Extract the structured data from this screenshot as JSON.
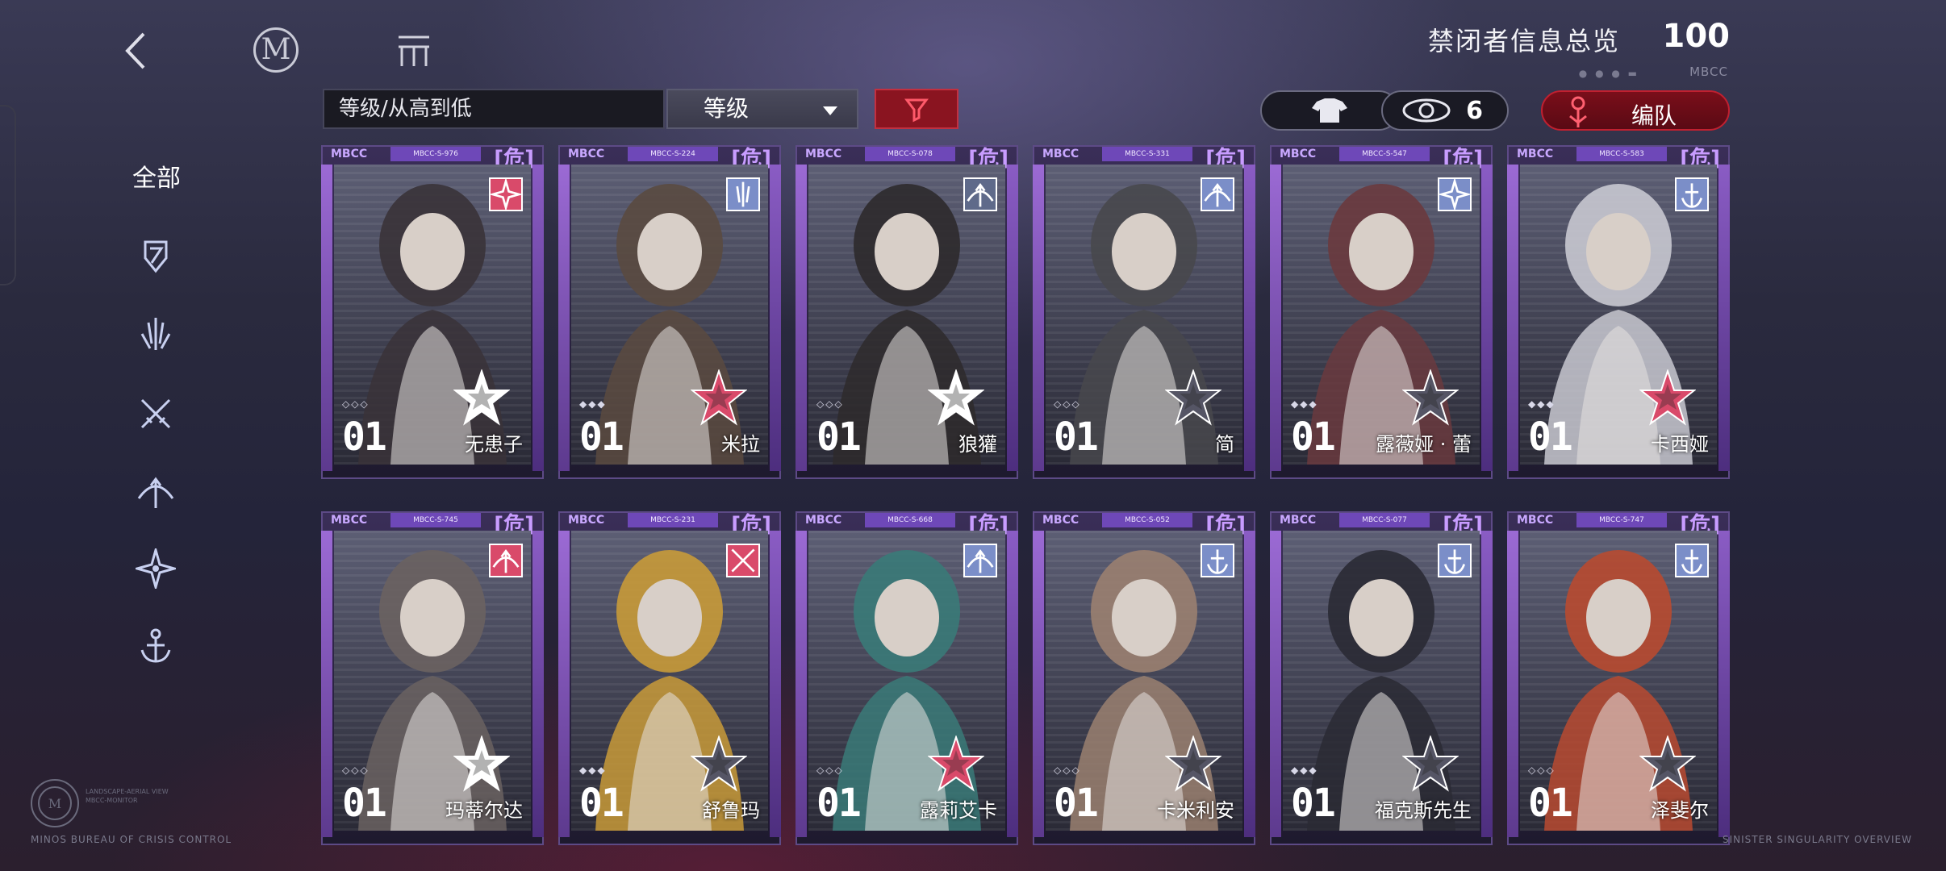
{
  "header": {
    "title": "禁闭者信息总览",
    "count": "100",
    "sub_tag": "MBCC",
    "dots": "● ● ● ▬"
  },
  "toolbar": {
    "sort_label": "等级/从高到低",
    "level_dropdown": "等级",
    "eye_count": "6",
    "team_label": "编队"
  },
  "sidebar": {
    "all_label": "全部",
    "filters": [
      "shield-icon",
      "claw-icon",
      "crossed-swords-icon",
      "bow-icon",
      "star-compass-icon",
      "anchor-icon"
    ]
  },
  "cards": [
    {
      "mbcc": "MBCC",
      "code": "MBCC-S-976",
      "danger": "[危]",
      "level": "01",
      "name": "无患子",
      "class_icon": "star-compass-icon",
      "class_color": "#d94a6a",
      "star_color": "#ffffff",
      "diamonds": "◇◇◇"
    },
    {
      "mbcc": "MBCC",
      "code": "MBCC-S-224",
      "danger": "[危]",
      "level": "01",
      "name": "米拉",
      "class_icon": "claw-icon",
      "class_color": "#7b8ec8",
      "star_color": "#d94a6a",
      "diamonds": "◆◆◆"
    },
    {
      "mbcc": "MBCC",
      "code": "MBCC-S-078",
      "danger": "[危]",
      "level": "01",
      "name": "狼獾",
      "class_icon": "bow-icon",
      "class_color": "#5f6a8a",
      "star_color": "#ffffff",
      "diamonds": "◇◇◇"
    },
    {
      "mbcc": "MBCC",
      "code": "MBCC-S-331",
      "danger": "[危]",
      "level": "01",
      "name": "简",
      "class_icon": "bow-icon",
      "class_color": "#7b8ec8",
      "star_color": "#555565",
      "diamonds": "◇◇◇"
    },
    {
      "mbcc": "MBCC",
      "code": "MBCC-S-547",
      "danger": "[危]",
      "level": "01",
      "name": "露薇娅 · 蕾",
      "class_icon": "star-compass-icon",
      "class_color": "#7b8ec8",
      "star_color": "#555565",
      "diamonds": "◆◆◆"
    },
    {
      "mbcc": "MBCC",
      "code": "MBCC-S-583",
      "danger": "[危]",
      "level": "01",
      "name": "卡西娅",
      "class_icon": "anchor-icon",
      "class_color": "#7b8ec8",
      "star_color": "#d94a6a",
      "diamonds": "◆◆◆"
    },
    {
      "mbcc": "MBCC",
      "code": "MBCC-S-745",
      "danger": "[危]",
      "level": "01",
      "name": "玛蒂尔达",
      "class_icon": "bow-icon",
      "class_color": "#d94a6a",
      "star_color": "#ffffff",
      "diamonds": "◇◇◇"
    },
    {
      "mbcc": "MBCC",
      "code": "MBCC-S-231",
      "danger": "[危]",
      "level": "01",
      "name": "舒鲁玛",
      "class_icon": "crossed-swords-icon",
      "class_color": "#d94a6a",
      "star_color": "#555565",
      "diamonds": "◆◆◆"
    },
    {
      "mbcc": "MBCC",
      "code": "MBCC-S-668",
      "danger": "[危]",
      "level": "01",
      "name": "露莉艾卡",
      "class_icon": "bow-icon",
      "class_color": "#7b8ec8",
      "star_color": "#d94a6a",
      "diamonds": "◇◇◇"
    },
    {
      "mbcc": "MBCC",
      "code": "MBCC-S-052",
      "danger": "[危]",
      "level": "01",
      "name": "卡米利安",
      "class_icon": "anchor-icon",
      "class_color": "#7b8ec8",
      "star_color": "#555565",
      "diamonds": "◇◇◇"
    },
    {
      "mbcc": "MBCC",
      "code": "MBCC-S-077",
      "danger": "[危]",
      "level": "01",
      "name": "福克斯先生",
      "class_icon": "anchor-icon",
      "class_color": "#7b8ec8",
      "star_color": "#555565",
      "diamonds": "◆◆◆"
    },
    {
      "mbcc": "MBCC",
      "code": "MBCC-S-747",
      "danger": "[危]",
      "level": "01",
      "name": "泽斐尔",
      "class_icon": "anchor-icon",
      "class_color": "#7b8ec8",
      "star_color": "#555565",
      "diamonds": "◇◇◇"
    }
  ],
  "footer": {
    "left_text": "MINOS BUREAU OF CRISIS CONTROL",
    "left_small": "LANDSCAPE-AERIAL VIEW\nMBCC-MONITOR",
    "right_text": "SINISTER SINGULARITY OVERVIEW"
  },
  "colors": {
    "accent_red": "#8a1420",
    "card_purple": "#6e48b8",
    "danger_violet": "#c89cff"
  }
}
